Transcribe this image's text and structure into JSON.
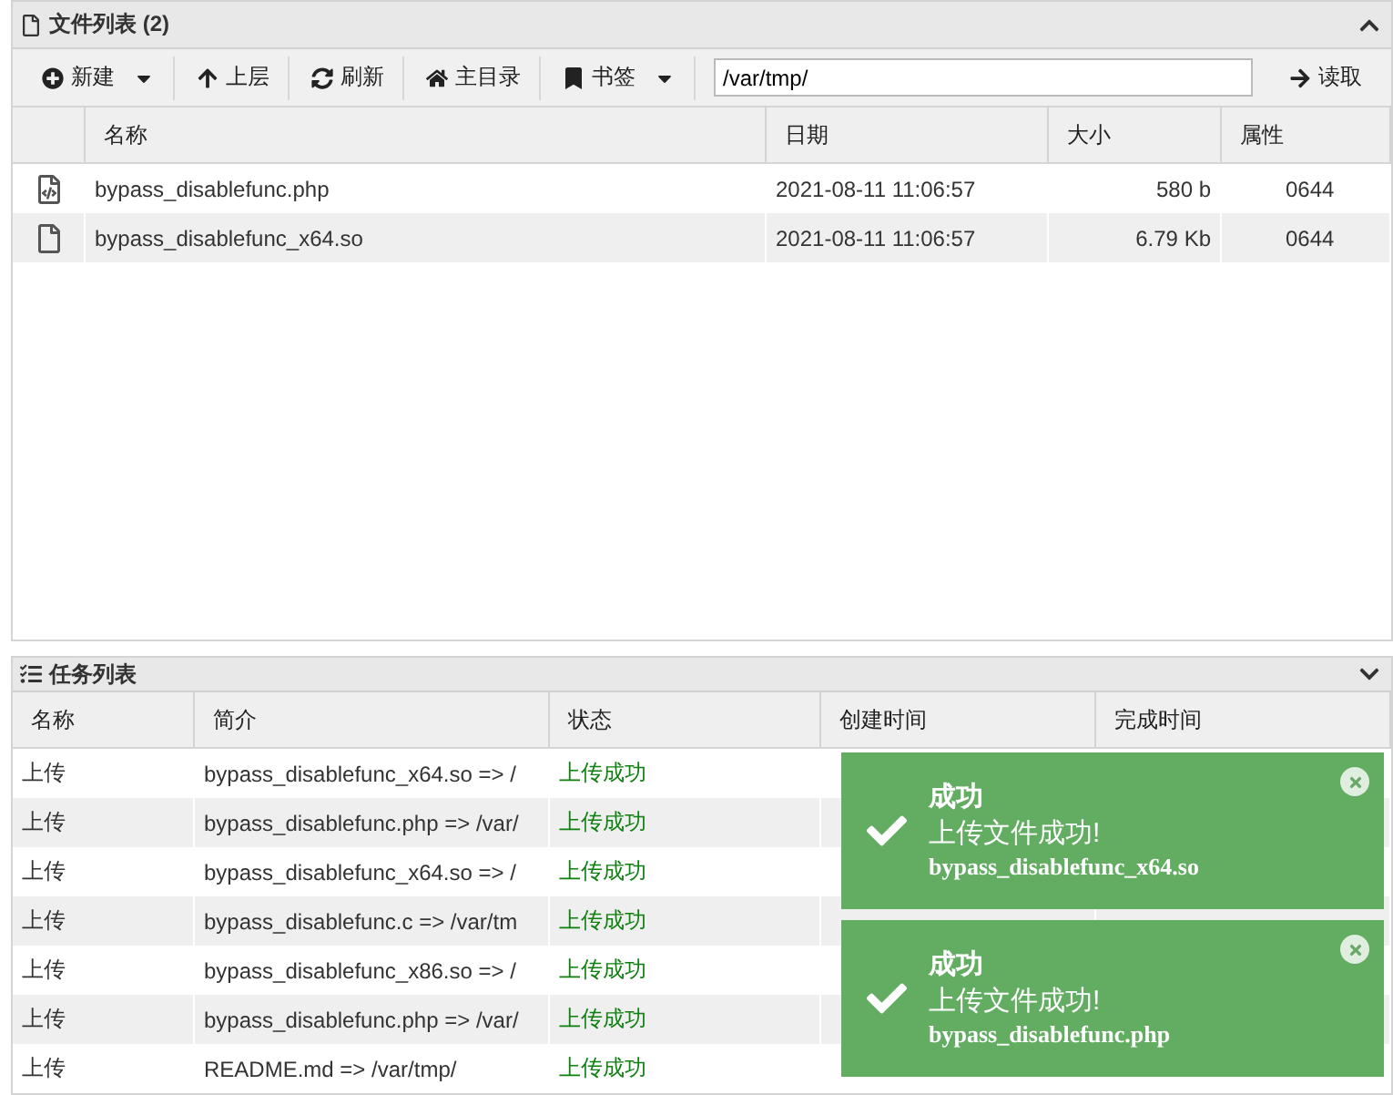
{
  "file_panel": {
    "title": "文件列表 (2)",
    "toolbar": {
      "buttons": [
        {
          "label": "新建",
          "kind": "new",
          "dropdown": true
        },
        {
          "label": "上层",
          "kind": "up",
          "dropdown": false
        },
        {
          "label": "刷新",
          "kind": "refresh",
          "dropdown": false
        },
        {
          "label": "主目录",
          "kind": "home",
          "dropdown": false
        },
        {
          "label": "书签",
          "kind": "bookmark",
          "dropdown": true
        }
      ],
      "path": "/var/tmp/",
      "read_button": "读取"
    },
    "columns": [
      "名称",
      "日期",
      "大小",
      "属性"
    ],
    "rows": [
      {
        "kind": "code",
        "name": "bypass_disablefunc.php",
        "date": "2021-08-11 11:06:57",
        "size": "580 b",
        "perm": "0644",
        "selected": false
      },
      {
        "kind": "file",
        "name": "bypass_disablefunc_x64.so",
        "date": "2021-08-11 11:06:57",
        "size": "6.79 Kb",
        "perm": "0644",
        "selected": true
      }
    ]
  },
  "task_panel": {
    "title": "任务列表",
    "columns": [
      "名称",
      "简介",
      "状态",
      "创建时间",
      "完成时间"
    ],
    "rows": [
      {
        "name": "上传",
        "summary": "bypass_disablefunc_x64.so => /",
        "status": "上传成功"
      },
      {
        "name": "上传",
        "summary": "bypass_disablefunc.php => /var/",
        "status": "上传成功"
      },
      {
        "name": "上传",
        "summary": "bypass_disablefunc_x64.so => /",
        "status": "上传成功"
      },
      {
        "name": "上传",
        "summary": "bypass_disablefunc.c => /var/tm",
        "status": "上传成功"
      },
      {
        "name": "上传",
        "summary": "bypass_disablefunc_x86.so => /",
        "status": "上传成功"
      },
      {
        "name": "上传",
        "summary": "bypass_disablefunc.php => /var/",
        "status": "上传成功"
      },
      {
        "name": "上传",
        "summary": "README.md => /var/tmp/",
        "status": "上传成功"
      }
    ]
  },
  "toasts": [
    {
      "title": "成功",
      "message": "上传文件成功!",
      "file": "bypass_disablefunc_x64.so"
    },
    {
      "title": "成功",
      "message": "上传文件成功!",
      "file": "bypass_disablefunc.php"
    }
  ]
}
